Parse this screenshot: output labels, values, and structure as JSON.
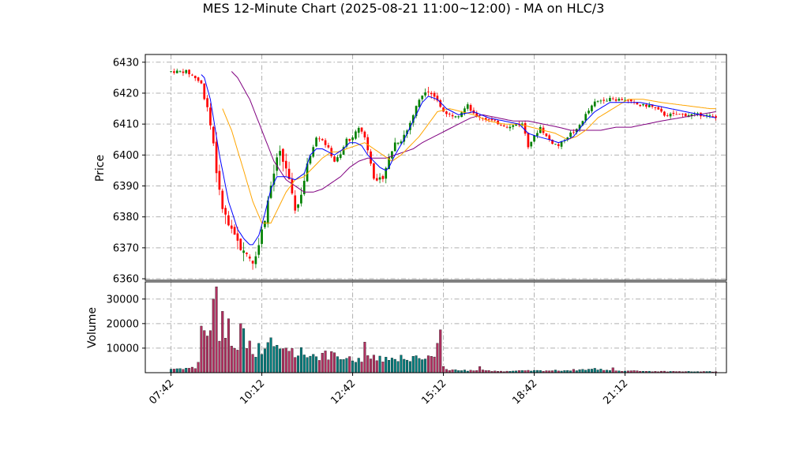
{
  "chart_data": {
    "type": "candlestick",
    "title": "MES 12-Minute Chart (2025-08-21 11:00~12:00) - MA on HLC/3",
    "price_panel": {
      "ylabel": "Price",
      "ylim": [
        6359.5,
        6432.5
      ],
      "yticks": [
        6360,
        6370,
        6380,
        6390,
        6400,
        6410,
        6420,
        6430
      ],
      "grid": true
    },
    "volume_panel": {
      "ylabel": "Volume",
      "ylim": [
        0,
        37000
      ],
      "yticks": [
        10000,
        20000,
        30000
      ],
      "grid": true
    },
    "x_axis": {
      "xlim": [
        -8.5,
        183.5
      ],
      "tick_positions": [
        0,
        30,
        60,
        90,
        120,
        150,
        180
      ],
      "tick_labels": [
        "07:42",
        "10:12",
        "12:42",
        "15:12",
        "18:42",
        "21:12",
        ""
      ]
    },
    "colors": {
      "up": "#008000",
      "down": "#ff0000",
      "vol_up": "#007a7a",
      "vol_down": "#b03060",
      "ma_short": "#0000ff",
      "ma_mid": "#ffa500",
      "ma_long": "#800080",
      "grid": "#b0b0b0"
    },
    "price_anchors": [
      [
        0,
        6427
      ],
      [
        5,
        6427
      ],
      [
        8,
        6425
      ],
      [
        10,
        6423
      ],
      [
        12,
        6414
      ],
      [
        14,
        6403
      ],
      [
        15,
        6393
      ],
      [
        17,
        6383
      ],
      [
        19,
        6377
      ],
      [
        21,
        6373
      ],
      [
        24,
        6369
      ],
      [
        26,
        6367
      ],
      [
        27,
        6366
      ],
      [
        29,
        6371
      ],
      [
        31,
        6380
      ],
      [
        33,
        6390
      ],
      [
        35,
        6398
      ],
      [
        36,
        6400
      ],
      [
        38,
        6396
      ],
      [
        40,
        6386
      ],
      [
        41,
        6383
      ],
      [
        42,
        6384
      ],
      [
        44,
        6392
      ],
      [
        46,
        6400
      ],
      [
        48,
        6406
      ],
      [
        50,
        6405
      ],
      [
        52,
        6402
      ],
      [
        54,
        6398
      ],
      [
        56,
        6400
      ],
      [
        58,
        6405
      ],
      [
        60,
        6405
      ],
      [
        62,
        6409
      ],
      [
        64,
        6406
      ],
      [
        66,
        6398
      ],
      [
        67,
        6393
      ],
      [
        68,
        6391
      ],
      [
        70,
        6393
      ],
      [
        72,
        6399
      ],
      [
        74,
        6404
      ],
      [
        76,
        6405
      ],
      [
        78,
        6408
      ],
      [
        80,
        6413
      ],
      [
        82,
        6418
      ],
      [
        84,
        6421
      ],
      [
        85,
        6421
      ],
      [
        87,
        6419
      ],
      [
        89,
        6416
      ],
      [
        90,
        6414
      ],
      [
        92,
        6413
      ],
      [
        95,
        6413
      ],
      [
        98,
        6416
      ],
      [
        100,
        6413
      ],
      [
        103,
        6412
      ],
      [
        106,
        6411
      ],
      [
        109,
        6410
      ],
      [
        112,
        6409
      ],
      [
        114,
        6410
      ],
      [
        116,
        6410
      ],
      [
        117,
        6407
      ],
      [
        118,
        6403
      ],
      [
        120,
        6406
      ],
      [
        122,
        6409
      ],
      [
        124,
        6406
      ],
      [
        126,
        6404
      ],
      [
        128,
        6403
      ],
      [
        130,
        6405
      ],
      [
        132,
        6407
      ],
      [
        134,
        6408
      ],
      [
        137,
        6413
      ],
      [
        140,
        6417
      ],
      [
        143,
        6418
      ],
      [
        147,
        6418
      ],
      [
        150,
        6418
      ],
      [
        152,
        6417
      ],
      [
        155,
        6416
      ],
      [
        158,
        6416
      ],
      [
        160,
        6415
      ],
      [
        163,
        6413
      ],
      [
        167,
        6413
      ],
      [
        170,
        6413
      ],
      [
        173,
        6413
      ],
      [
        176,
        6413
      ],
      [
        180,
        6412
      ]
    ],
    "ma_short_anchors": [
      [
        10,
        6426
      ],
      [
        11,
        6425
      ],
      [
        13,
        6418
      ],
      [
        16,
        6400
      ],
      [
        19,
        6385
      ],
      [
        22,
        6376
      ],
      [
        24,
        6373
      ],
      [
        26,
        6371
      ],
      [
        27,
        6371
      ],
      [
        29,
        6374
      ],
      [
        31,
        6381
      ],
      [
        33,
        6389
      ],
      [
        35,
        6393
      ],
      [
        38,
        6393
      ],
      [
        41,
        6392
      ],
      [
        44,
        6394
      ],
      [
        46,
        6400
      ],
      [
        48,
        6402
      ],
      [
        50,
        6402
      ],
      [
        52,
        6401
      ],
      [
        54,
        6400
      ],
      [
        57,
        6402
      ],
      [
        59,
        6404
      ],
      [
        61,
        6404
      ],
      [
        63,
        6403
      ],
      [
        65,
        6400
      ],
      [
        67,
        6398
      ],
      [
        69,
        6396
      ],
      [
        71,
        6395
      ],
      [
        72,
        6396
      ],
      [
        74,
        6400
      ],
      [
        77,
        6405
      ],
      [
        80,
        6411
      ],
      [
        83,
        6417
      ],
      [
        85,
        6419
      ],
      [
        88,
        6418
      ],
      [
        91,
        6415
      ],
      [
        95,
        6413
      ],
      [
        100,
        6414
      ],
      [
        105,
        6412
      ],
      [
        110,
        6411
      ],
      [
        115,
        6410
      ],
      [
        118,
        6407
      ],
      [
        121,
        6406
      ],
      [
        125,
        6405
      ],
      [
        128,
        6404
      ],
      [
        131,
        6405
      ],
      [
        133,
        6406
      ],
      [
        137,
        6411
      ],
      [
        140,
        6414
      ],
      [
        145,
        6417
      ],
      [
        150,
        6417
      ],
      [
        155,
        6417
      ],
      [
        160,
        6416
      ],
      [
        165,
        6415
      ],
      [
        170,
        6414
      ],
      [
        175,
        6413
      ],
      [
        180,
        6412
      ]
    ],
    "ma_mid_anchors": [
      [
        17,
        6415
      ],
      [
        20,
        6408
      ],
      [
        24,
        6395
      ],
      [
        27,
        6385
      ],
      [
        30,
        6378
      ],
      [
        33,
        6378
      ],
      [
        35,
        6382
      ],
      [
        38,
        6388
      ],
      [
        41,
        6392
      ],
      [
        44,
        6393
      ],
      [
        47,
        6396
      ],
      [
        50,
        6399
      ],
      [
        53,
        6401
      ],
      [
        55,
        6401
      ],
      [
        58,
        6402
      ],
      [
        61,
        6403
      ],
      [
        64,
        6404
      ],
      [
        67,
        6402
      ],
      [
        70,
        6400
      ],
      [
        73,
        6398
      ],
      [
        76,
        6400
      ],
      [
        79,
        6403
      ],
      [
        82,
        6406
      ],
      [
        85,
        6410
      ],
      [
        88,
        6414
      ],
      [
        92,
        6415
      ],
      [
        96,
        6414
      ],
      [
        100,
        6413
      ],
      [
        105,
        6411
      ],
      [
        110,
        6410
      ],
      [
        115,
        6410
      ],
      [
        119,
        6409
      ],
      [
        123,
        6408
      ],
      [
        127,
        6407
      ],
      [
        131,
        6405
      ],
      [
        134,
        6406
      ],
      [
        137,
        6408
      ],
      [
        141,
        6412
      ],
      [
        146,
        6415
      ],
      [
        151,
        6418
      ],
      [
        156,
        6418
      ],
      [
        162,
        6417
      ],
      [
        170,
        6416
      ],
      [
        178,
        6415
      ],
      [
        180,
        6415
      ]
    ],
    "ma_long_anchors": [
      [
        20,
        6427
      ],
      [
        22,
        6425
      ],
      [
        26,
        6418
      ],
      [
        30,
        6408
      ],
      [
        34,
        6398
      ],
      [
        38,
        6392
      ],
      [
        41,
        6390
      ],
      [
        44,
        6388
      ],
      [
        47,
        6388
      ],
      [
        50,
        6389
      ],
      [
        53,
        6391
      ],
      [
        56,
        6393
      ],
      [
        59,
        6396
      ],
      [
        62,
        6398
      ],
      [
        65,
        6399
      ],
      [
        68,
        6399
      ],
      [
        71,
        6399
      ],
      [
        74,
        6400
      ],
      [
        77,
        6401
      ],
      [
        80,
        6402
      ],
      [
        83,
        6404
      ],
      [
        87,
        6406
      ],
      [
        91,
        6408
      ],
      [
        95,
        6410
      ],
      [
        99,
        6412
      ],
      [
        103,
        6413
      ],
      [
        108,
        6412
      ],
      [
        113,
        6411
      ],
      [
        118,
        6411
      ],
      [
        123,
        6410
      ],
      [
        128,
        6409
      ],
      [
        132,
        6408
      ],
      [
        137,
        6408
      ],
      [
        142,
        6408
      ],
      [
        147,
        6409
      ],
      [
        152,
        6409
      ],
      [
        157,
        6410
      ],
      [
        162,
        6411
      ],
      [
        168,
        6412
      ],
      [
        174,
        6413
      ],
      [
        180,
        6414
      ]
    ],
    "volume_anchors": [
      [
        0,
        1500
      ],
      [
        8,
        2000
      ],
      [
        9,
        4500
      ],
      [
        10,
        16000
      ],
      [
        12,
        15000
      ],
      [
        13,
        20000
      ],
      [
        14,
        30000
      ],
      [
        15,
        35000
      ],
      [
        16,
        18000
      ],
      [
        17,
        25000
      ],
      [
        18,
        20000
      ],
      [
        19,
        17000
      ],
      [
        20,
        14000
      ],
      [
        22,
        11000
      ],
      [
        24,
        9000
      ],
      [
        26,
        11000
      ],
      [
        28,
        9000
      ],
      [
        30,
        10000
      ],
      [
        32,
        12000
      ],
      [
        34,
        11000
      ],
      [
        36,
        9000
      ],
      [
        38,
        10000
      ],
      [
        40,
        9000
      ],
      [
        44,
        8000
      ],
      [
        48,
        7000
      ],
      [
        52,
        7000
      ],
      [
        56,
        6000
      ],
      [
        60,
        5000
      ],
      [
        62,
        5000
      ],
      [
        64,
        6000
      ],
      [
        66,
        8000
      ],
      [
        68,
        7000
      ],
      [
        70,
        6000
      ],
      [
        74,
        6000
      ],
      [
        78,
        6000
      ],
      [
        82,
        6000
      ],
      [
        84,
        5000
      ],
      [
        86,
        6000
      ],
      [
        87,
        8000
      ],
      [
        88,
        12000
      ],
      [
        89,
        17500
      ],
      [
        90,
        2000
      ],
      [
        92,
        1200
      ],
      [
        95,
        800
      ],
      [
        100,
        1000
      ],
      [
        110,
        600
      ],
      [
        120,
        800
      ],
      [
        130,
        900
      ],
      [
        140,
        1500
      ],
      [
        145,
        1000
      ],
      [
        155,
        600
      ],
      [
        165,
        500
      ],
      [
        180,
        400
      ]
    ],
    "volume_spikes": [
      [
        14,
        30000
      ],
      [
        15,
        35000
      ],
      [
        17,
        25000
      ],
      [
        23,
        20000
      ],
      [
        24,
        18000
      ],
      [
        88,
        12000
      ],
      [
        89,
        17500
      ],
      [
        64,
        12500
      ],
      [
        10,
        19000
      ],
      [
        102,
        2500
      ],
      [
        146,
        2000
      ]
    ]
  }
}
